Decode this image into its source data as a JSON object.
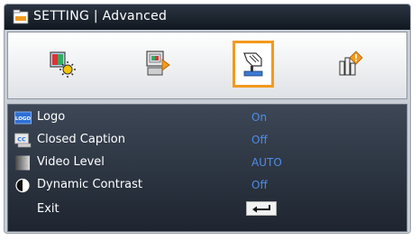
{
  "window": {
    "title": "SETTING | Advanced",
    "title_icon": "setting-folder-icon"
  },
  "tabs": [
    {
      "icon": "display-brightness-icon",
      "active": false
    },
    {
      "icon": "projector-setup-icon",
      "active": false
    },
    {
      "icon": "hand-pointer-settings-icon",
      "active": true
    },
    {
      "icon": "info-diamond-icon",
      "active": false
    }
  ],
  "menu": {
    "items": [
      {
        "label": "Logo",
        "value": "On",
        "icon": "logo-icon",
        "icon_text": "LOGO"
      },
      {
        "label": "Closed Caption",
        "value": "Off",
        "icon": "closed-caption-icon",
        "icon_text": "CC"
      },
      {
        "label": "Video Level",
        "value": "AUTO",
        "icon": "video-level-icon"
      },
      {
        "label": "Dynamic Contrast",
        "value": "Off",
        "icon": "dynamic-contrast-icon"
      },
      {
        "label": "Exit",
        "value": "",
        "icon": "enter-key-icon"
      }
    ]
  },
  "colors": {
    "accent": "#f39a1c",
    "value_text": "#4d8ee8",
    "title_bar": "#1a222c"
  }
}
